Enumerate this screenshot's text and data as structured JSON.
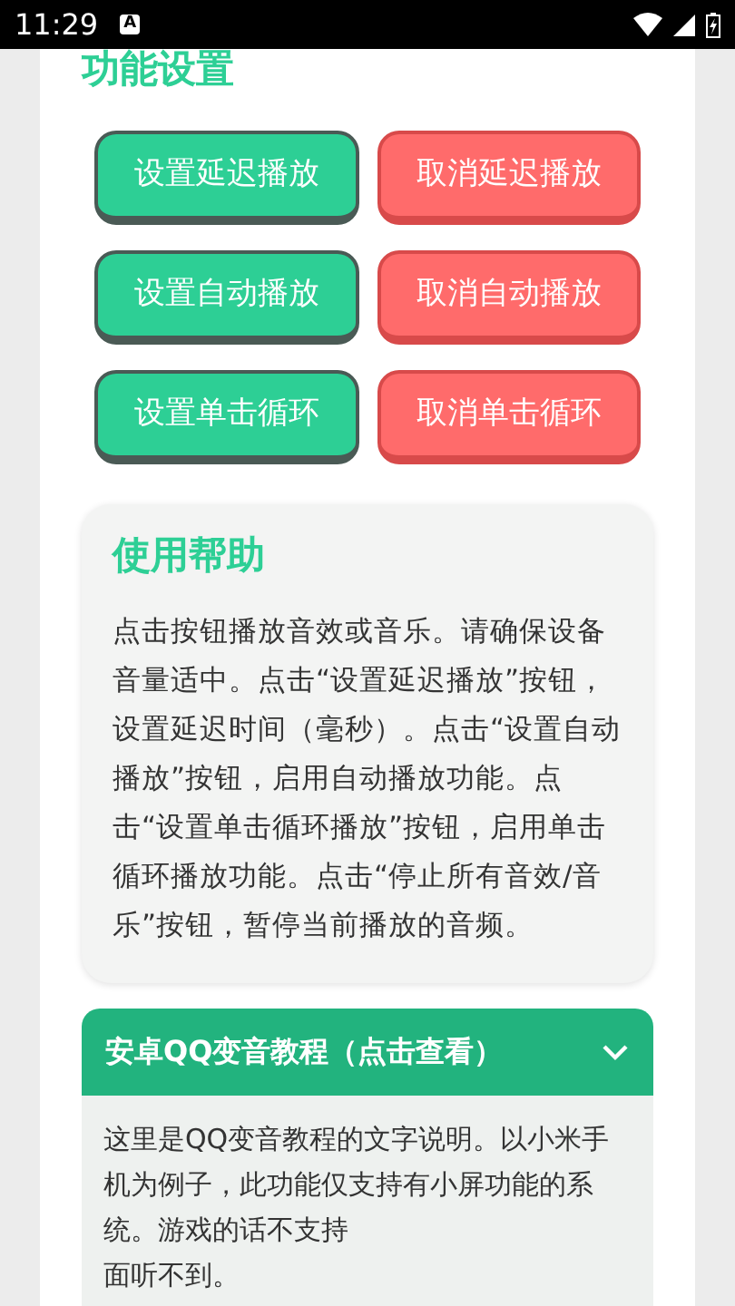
{
  "status_bar": {
    "time": "11:29",
    "notification": "A"
  },
  "section_title": "功能设置",
  "buttons": [
    {
      "label": "设置延迟播放",
      "kind": "set"
    },
    {
      "label": "取消延迟播放",
      "kind": "cancel"
    },
    {
      "label": "设置自动播放",
      "kind": "set"
    },
    {
      "label": "取消自动播放",
      "kind": "cancel"
    },
    {
      "label": "设置单击循环",
      "kind": "set"
    },
    {
      "label": "取消单击循环",
      "kind": "cancel"
    }
  ],
  "help": {
    "title": "使用帮助",
    "text": "点击按钮播放音效或音乐。请确保设备音量适中。点击“设置延迟播放”按钮，设置延迟时间（毫秒）。点击“设置自动播放”按钮，启用自动播放功能。点击“设置单击循环播放”按钮，启用单击循环播放功能。点击“停止所有音效/音乐”按钮，暂停当前播放的音频。"
  },
  "tutorial": {
    "title": "安卓QQ变音教程（点击查看）",
    "expanded": true,
    "lines": [
      "这里是QQ变音教程的文字说明。以小米手",
      "机为例子，此功能仅支持有小屏功能的系",
      "统。游戏的话不支持",
      "面听不到。"
    ]
  }
}
